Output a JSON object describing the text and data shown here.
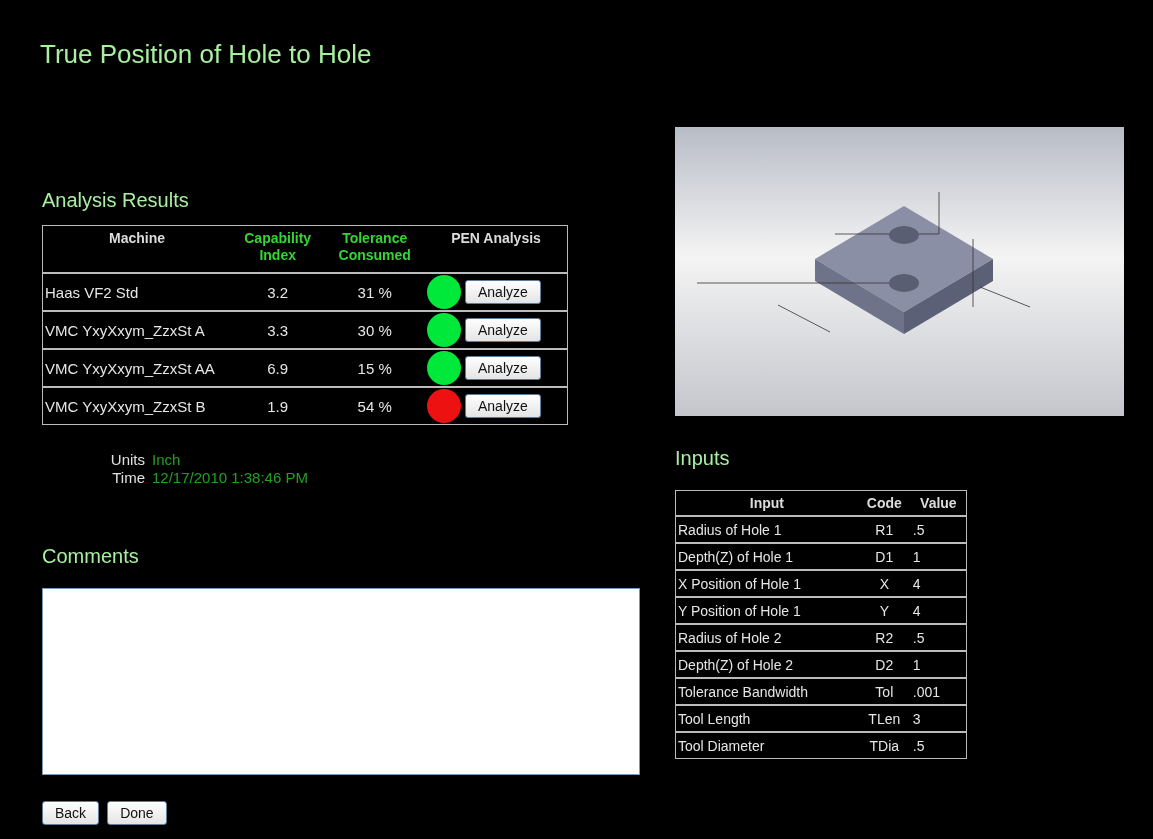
{
  "title": "True Position of Hole to Hole",
  "analysis": {
    "heading": "Analysis Results",
    "columns": [
      {
        "line1": "Machine",
        "kind": "plain"
      },
      {
        "line1": "Capability",
        "line2": "Index",
        "kind": "metric"
      },
      {
        "line1": "Tolerance",
        "line2": "Consumed",
        "kind": "metric"
      },
      {
        "line1": "PEN Analysis",
        "kind": "plain"
      }
    ],
    "rows": [
      {
        "machine": "Haas VF2 Std",
        "capability_index": "3.2",
        "tolerance_consumed": "31 %",
        "color": "#00e83a",
        "button": "Analyze"
      },
      {
        "machine": "VMC YxyXxym_ZzxSt A",
        "capability_index": "3.3",
        "tolerance_consumed": "30 %",
        "color": "#00e83a",
        "button": "Analyze"
      },
      {
        "machine": "VMC YxyXxym_ZzxSt AA",
        "capability_index": "6.9",
        "tolerance_consumed": "15 %",
        "color": "#00e83a",
        "button": "Analyze"
      },
      {
        "machine": "VMC YxyXxym_ZzxSt B",
        "capability_index": "1.9",
        "tolerance_consumed": "54 %",
        "color": "#ee1111",
        "button": "Analyze"
      }
    ]
  },
  "meta": [
    {
      "label": "Units",
      "value": "Inch"
    },
    {
      "label": "Time",
      "value": "12/17/2010 1:38:46 PM"
    }
  ],
  "comments": {
    "heading": "Comments"
  },
  "buttons": [
    "Back",
    "Done"
  ],
  "figure": {
    "kind": "picture"
  },
  "inputs": {
    "heading": "Inputs",
    "columns": [
      "Input",
      "Code",
      "Value"
    ],
    "rows": [
      {
        "input": "Radius of Hole 1",
        "code": "R1",
        "value": ".5"
      },
      {
        "input": "Depth(Z) of Hole 1",
        "code": "D1",
        "value": "1"
      },
      {
        "input": "X Position of Hole 1",
        "code": "X",
        "value": "4"
      },
      {
        "input": "Y Position of Hole 1",
        "code": "Y",
        "value": "4"
      },
      {
        "input": "Radius of Hole 2",
        "code": "R2",
        "value": ".5"
      },
      {
        "input": "Depth(Z) of Hole 2",
        "code": "D2",
        "value": "1"
      },
      {
        "input": "Tolerance Bandwidth",
        "code": "Tol",
        "value": ".001"
      },
      {
        "input": "Tool Length",
        "code": "TLen",
        "value": "3"
      },
      {
        "input": "Tool Diameter",
        "code": "TDia",
        "value": ".5"
      }
    ]
  }
}
